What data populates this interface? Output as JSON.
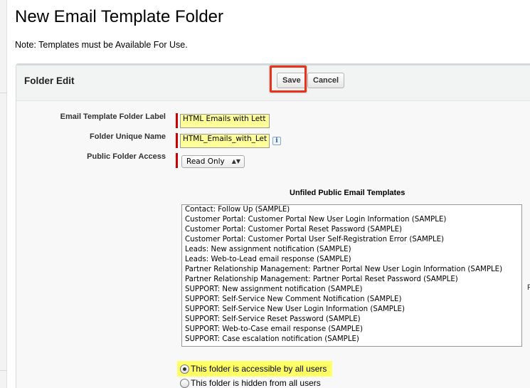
{
  "page": {
    "title": "New Email Template Folder",
    "note": "Note: Templates must be Available For Use."
  },
  "panel": {
    "title": "Folder Edit",
    "save_label": "Save",
    "cancel_label": "Cancel"
  },
  "fields": {
    "label_label": "Email Template Folder Label",
    "label_value": "HTML Emails with Lett",
    "unique_name_label": "Folder Unique Name",
    "unique_name_value": "HTML_Emails_with_Let",
    "info_icon": "i",
    "access_label": "Public Folder Access",
    "access_value": "Read Only",
    "chevron": "▲▼"
  },
  "templates": {
    "title": "Unfiled Public Email Templates",
    "items": [
      "Contact: Follow Up (SAMPLE)",
      "Customer Portal: Customer Portal New User Login Information (SAMPLE)",
      "Customer Portal: Customer Portal Reset Password (SAMPLE)",
      "Customer Portal: Customer Portal User Self-Registration Error (SAMPLE)",
      "Leads: New assignment notification (SAMPLE)",
      "Leads: Web-to-Lead email response (SAMPLE)",
      "Partner Relationship Management: Partner Portal New User Login Information (SAMPLE)",
      "Partner Relationship Management: Partner Portal Reset Password (SAMPLE)",
      "SUPPORT: New assignment notification (SAMPLE)",
      "SUPPORT: Self-Service New Comment Notification (SAMPLE)",
      "SUPPORT: Self-Service New User Login Information (SAMPLE)",
      "SUPPORT: Self-Service Reset Password (SAMPLE)",
      "SUPPORT: Web-to-Case email response (SAMPLE)",
      "SUPPORT: Case escalation notification (SAMPLE)"
    ],
    "side_letter": "F"
  },
  "visibility": {
    "all_users_label": "This folder is accessible by all users",
    "hidden_label": "This folder is hidden from all users",
    "selected": "all_users"
  },
  "colors": {
    "required": "#cc0000",
    "highlight_box": "#e8321b",
    "input_highlight": "#ffff99",
    "radio_highlight": "#ffff66"
  }
}
